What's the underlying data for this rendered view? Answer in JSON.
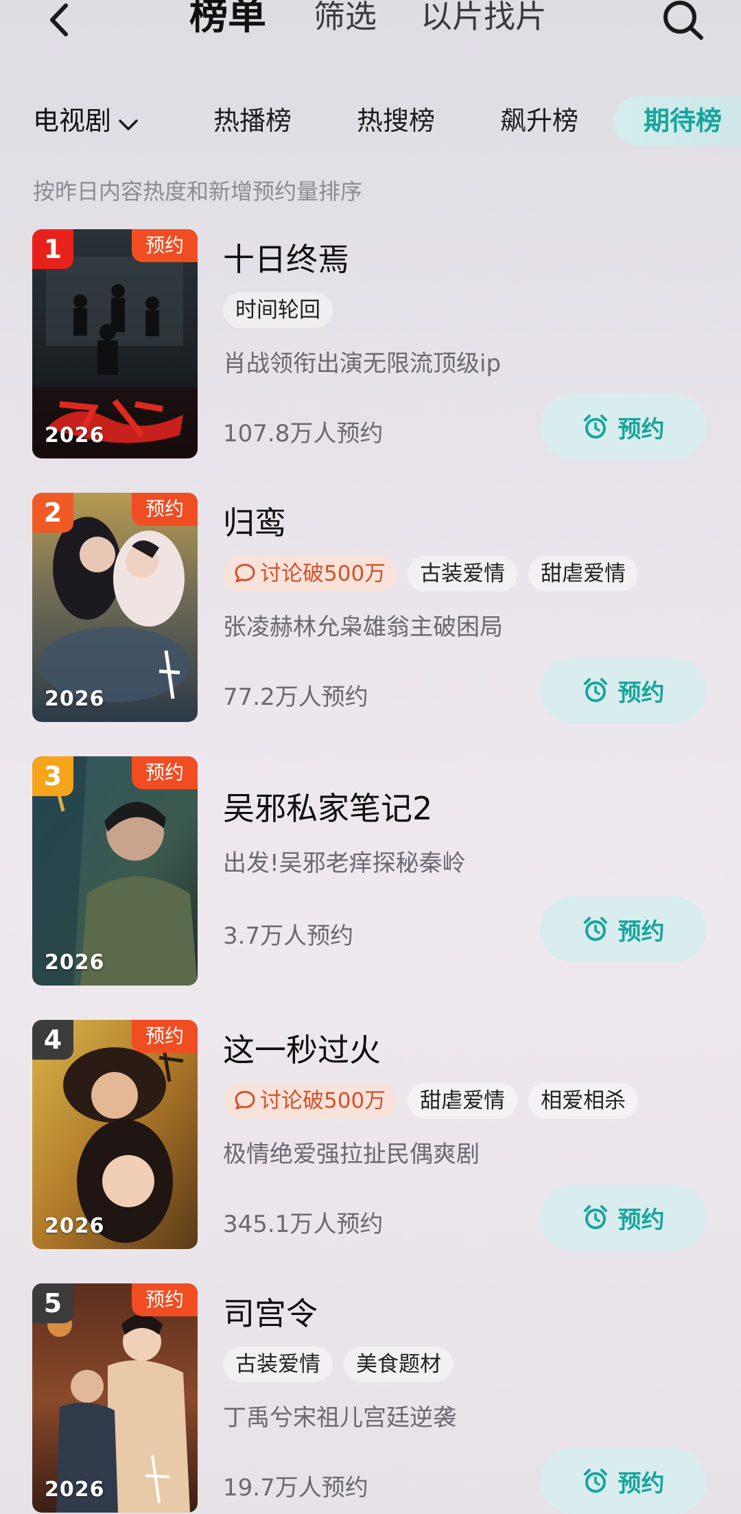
{
  "header": {
    "title": "榜单",
    "filter": "筛选",
    "find_by_clip": "以片找片",
    "back_icon": "chevron-left-icon",
    "search_icon": "search-icon"
  },
  "categories": {
    "type_selector": "电视剧",
    "tabs": [
      "热播榜",
      "热搜榜",
      "飙升榜",
      "期待榜"
    ],
    "active_tab": "期待榜"
  },
  "sort_note": "按昨日内容热度和新增预约量排序",
  "colors": {
    "accent": "#17a59c",
    "reserve_tag": "#f04d22",
    "rank1": "#e8211b",
    "rank2": "#f05a24",
    "rank3": "#f6a51b",
    "rank_other": "#3b3b3b"
  },
  "list": [
    {
      "rank": "1",
      "tag_label": "预约",
      "year": "2026",
      "title": "十日终焉",
      "hot": "",
      "genres": [
        "时间轮回"
      ],
      "description": "肖战领衔出演无限流顶级ip",
      "reservations": "107.8万人预约",
      "button_label": "预约"
    },
    {
      "rank": "2",
      "tag_label": "预约",
      "year": "2026",
      "title": "归鸾",
      "hot": "讨论破500万",
      "genres": [
        "古装爱情",
        "甜虐爱情"
      ],
      "description": "张凌赫林允枭雄翁主破困局",
      "reservations": "77.2万人预约",
      "button_label": "预约"
    },
    {
      "rank": "3",
      "tag_label": "预约",
      "year": "2026",
      "title": "吴邪私家笔记2",
      "hot": "",
      "genres": [],
      "description": "出发!吴邪老痒探秘秦岭",
      "reservations": "3.7万人预约",
      "button_label": "预约"
    },
    {
      "rank": "4",
      "tag_label": "预约",
      "year": "2026",
      "title": "这一秒过火",
      "hot": "讨论破500万",
      "genres": [
        "甜虐爱情",
        "相爱相杀"
      ],
      "description": "极情绝爱强拉扯民偶爽剧",
      "reservations": "345.1万人预约",
      "button_label": "预约"
    },
    {
      "rank": "5",
      "tag_label": "预约",
      "year": "2026",
      "title": "司宫令",
      "hot": "",
      "genres": [
        "古装爱情",
        "美食题材"
      ],
      "description": "丁禹兮宋祖儿宫廷逆袭",
      "reservations": "19.7万人预约",
      "button_label": "预约"
    }
  ]
}
